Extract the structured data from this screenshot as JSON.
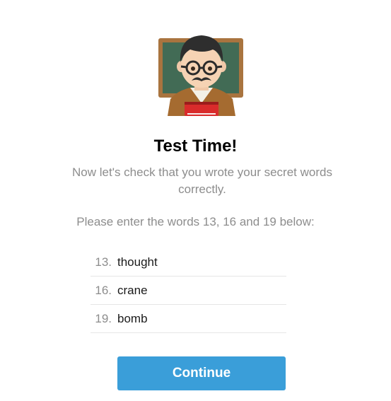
{
  "illustration": {
    "icon": "teacher-icon"
  },
  "heading": {
    "title": "Test Time!",
    "subtitle": "Now let's check that you wrote your secret words correctly.",
    "instruction": "Please enter the words 13, 16 and 19 below:"
  },
  "words": [
    {
      "number": "13.",
      "value": "thought"
    },
    {
      "number": "16.",
      "value": "crane"
    },
    {
      "number": "19.",
      "value": "bomb"
    }
  ],
  "actions": {
    "continue_label": "Continue"
  },
  "colors": {
    "accent": "#3a9ed9",
    "muted_text": "#8d8d8d",
    "divider": "#e6e6e6"
  }
}
